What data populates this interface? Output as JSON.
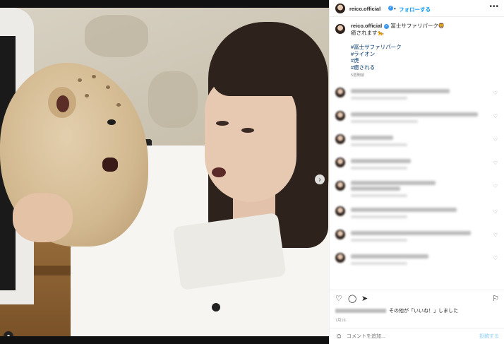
{
  "header": {
    "username": "reico.official",
    "follow_label": "フォローする",
    "more_icon": "•••"
  },
  "caption": {
    "username": "reico.official",
    "line1": "富士サファリパーク🦁",
    "line2": "癒されます🐆",
    "hashtags": [
      "#富士サファリパーク",
      "#ライオン",
      "#虎",
      "#癒される"
    ],
    "time": "5週間前"
  },
  "comments": [
    {
      "name_blurred": true,
      "emoji_color": "#e0b44a"
    },
    {
      "name_blurred": true,
      "emoji_color": "#e0b44a"
    },
    {
      "name_blurred": true,
      "emoji_color": "#e0b44a"
    },
    {
      "name_blurred": true,
      "emoji_color": "#e0b44a"
    },
    {
      "name_blurred": true,
      "emoji_color": "#e05a6a"
    },
    {
      "name_blurred": true,
      "emoji_color": "#e0b44a"
    },
    {
      "name_blurred": true,
      "emoji_color": "#e0b44a"
    },
    {
      "name_blurred": true,
      "emoji_color": "#e0b44a"
    }
  ],
  "likes": {
    "text": "その他が「いいね！」しました"
  },
  "date": "7月16",
  "comment_box": {
    "placeholder": "コメントを追加...",
    "post_label": "投稿する"
  },
  "colors": {
    "accent": "#0095f6",
    "verified": "#3897f0",
    "hashtag": "#00376b"
  }
}
